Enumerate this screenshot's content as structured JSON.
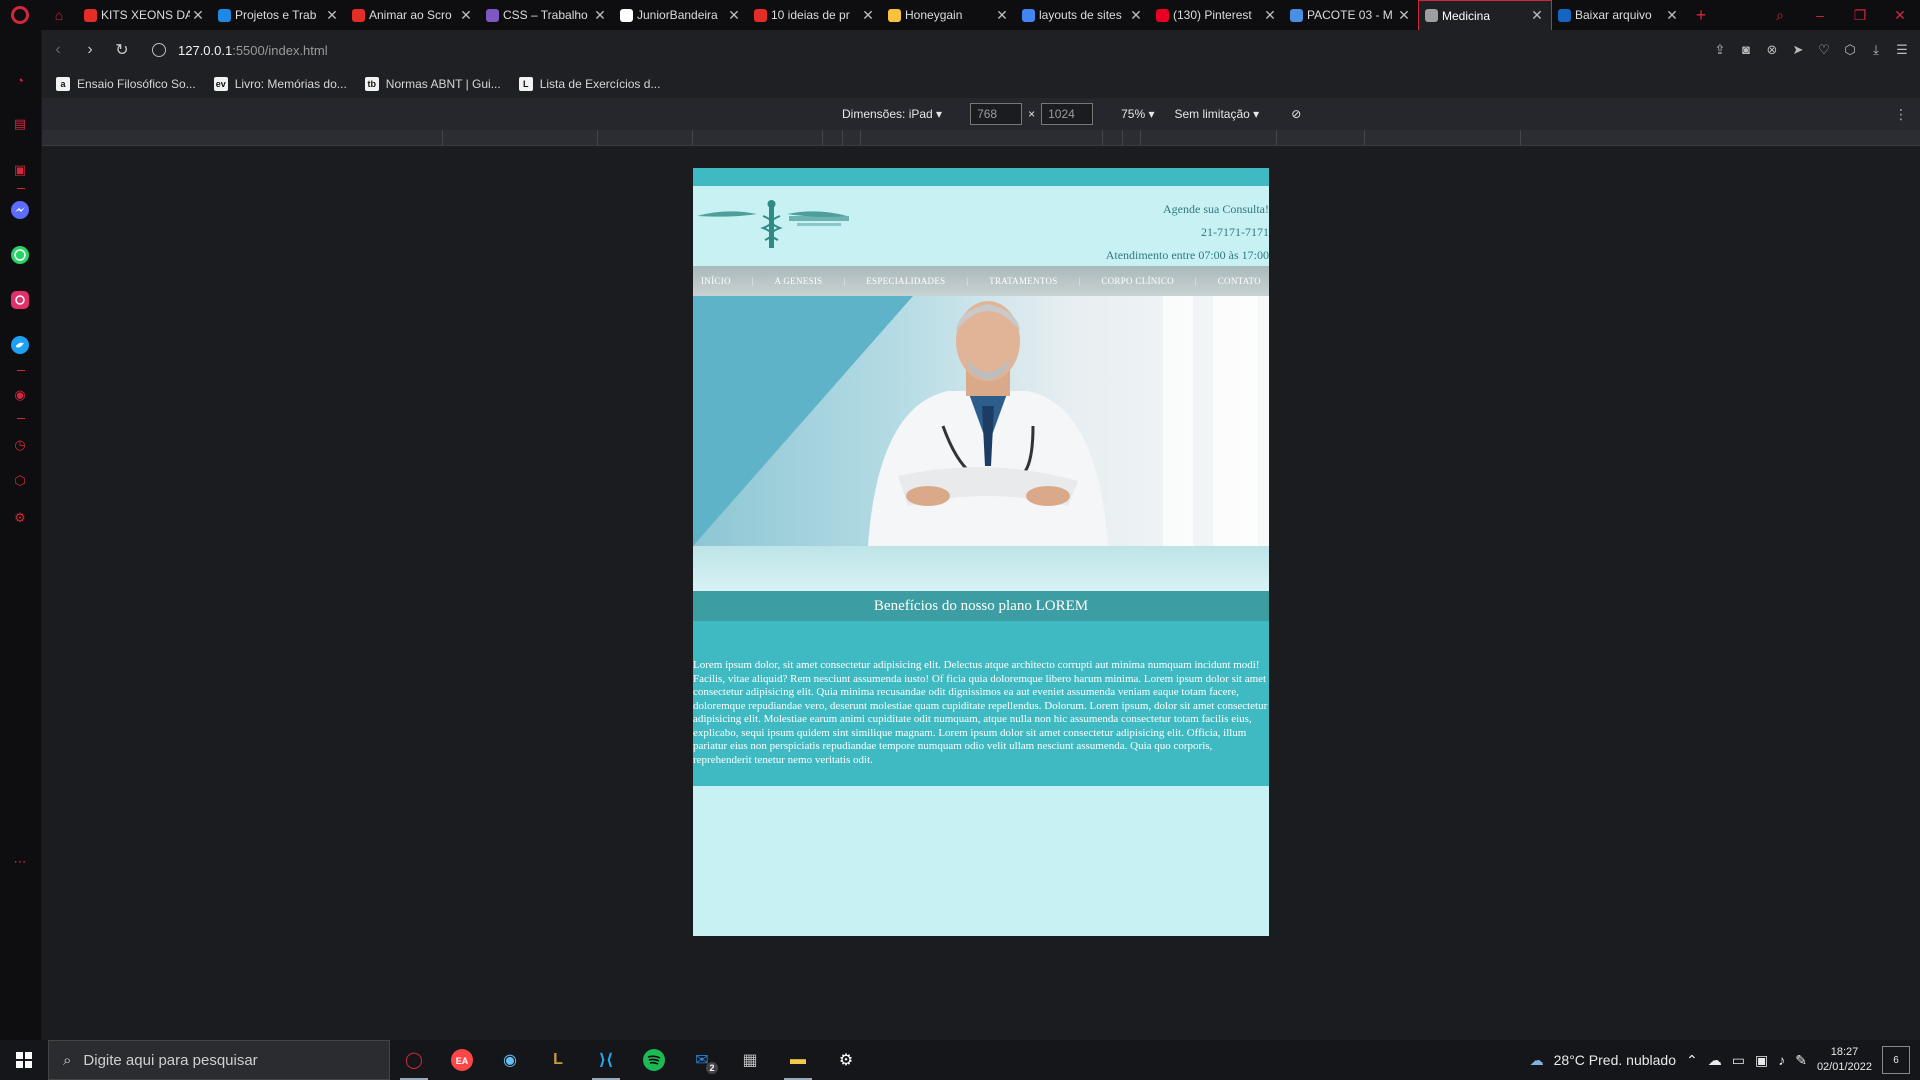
{
  "browser": {
    "tabs": [
      {
        "title": "KITS XEONS DA",
        "icon": "youtube-icon",
        "color": "#e52d27"
      },
      {
        "title": "Projetos e Trab",
        "icon": "projects-icon",
        "color": "#1e88e5"
      },
      {
        "title": "Animar ao Scro",
        "icon": "youtube-icon",
        "color": "#e52d27"
      },
      {
        "title": "CSS – Trabalho",
        "icon": "circle-icon",
        "color": "#7e57c2"
      },
      {
        "title": "JuniorBandeira",
        "icon": "github-icon",
        "color": "#ffffff"
      },
      {
        "title": "10 ideias de pr",
        "icon": "youtube-icon",
        "color": "#e52d27"
      },
      {
        "title": "Honeygain",
        "icon": "honeygain-icon",
        "color": "#f9c23c"
      },
      {
        "title": "layouts de sites",
        "icon": "google-icon",
        "color": "#4285f4"
      },
      {
        "title": "(130) Pinterest",
        "icon": "pinterest-icon",
        "color": "#e60023"
      },
      {
        "title": "PACOTE 03 - M",
        "icon": "package-icon",
        "color": "#4a90e2"
      },
      {
        "title": "Medicina",
        "icon": "globe-icon",
        "color": "#9e9e9e"
      },
      {
        "title": "Baixar arquivo",
        "icon": "download-site-icon",
        "color": "#1565c0"
      }
    ],
    "active_tab_index": 10,
    "url_host": "127.0.0.1",
    "url_path": ":5500/index.html",
    "bookmarks": [
      {
        "label": "Ensaio Filosófico So...",
        "badge": "a"
      },
      {
        "label": "Livro: Memórias do...",
        "badge": "ev"
      },
      {
        "label": "Normas ABNT | Gui...",
        "badge": "tb"
      },
      {
        "label": "Lista de Exercícios d...",
        "badge": "L"
      }
    ]
  },
  "devtools": {
    "dimensions_label": "Dimensões: iPad ▾",
    "width": "768",
    "height": "1024",
    "times": "×",
    "zoom": "75% ▾",
    "throttle": "Sem limitação ▾"
  },
  "site": {
    "contact": {
      "line1": "Agende sua Consulta!",
      "line2": "21-7171-7171",
      "line3": "Atendimento entre 07:00 às 17:00"
    },
    "nav": [
      "INÍCIO",
      "A GENESIS",
      "ESPECIALIDADES",
      "TRATAMENTOS",
      "CORPO CLÍNICO",
      "CONTATO"
    ],
    "benefits_title": "Benefícios do nosso plano LOREM",
    "benefits_text": "Lorem ipsum dolor, sit amet consectetur adipisicing elit. Delectus atque architecto corrupti aut minima numquam incidunt modi! Facilis, vitae aliquid? Rem nesciunt assumenda iusto! Of ficia quia doloremque libero harum minima. Lorem ipsum dolor sit amet consectetur adipisicing elit. Quia minima recusandae odit dignissimos ea aut eveniet assumenda veniam eaque totam facere, doloremque repudiandae vero, deserunt molestiae quam cupiditate repellendus. Dolorum. Lorem ipsum, dolor sit amet consectetur adipisicing elit. Molestiae earum animi cupiditate odit numquam, atque nulla non hic assumenda consectetur totam facilis eius, explicabo, sequi ipsum quidem sint similique magnam. Lorem ipsum dolor sit amet consectetur adipisicing elit. Officia, illum pariatur eius non perspiciatis repudiandae tempore numquam odio velit ullam nesciunt assumenda. Quia quo corporis, reprehenderit tenetur nemo veritatis odit."
  },
  "taskbar": {
    "search_placeholder": "Digite aqui para pesquisar",
    "weather": "28°C  Pred. nublado",
    "time": "18:27",
    "date": "02/01/2022",
    "notifications": "6",
    "mail_badge": "2"
  },
  "colors": {
    "accent": "#d0273d",
    "site_teal": "#3fbac2",
    "site_light": "#c8f1f4",
    "site_dark_teal": "#3c9ea3"
  }
}
